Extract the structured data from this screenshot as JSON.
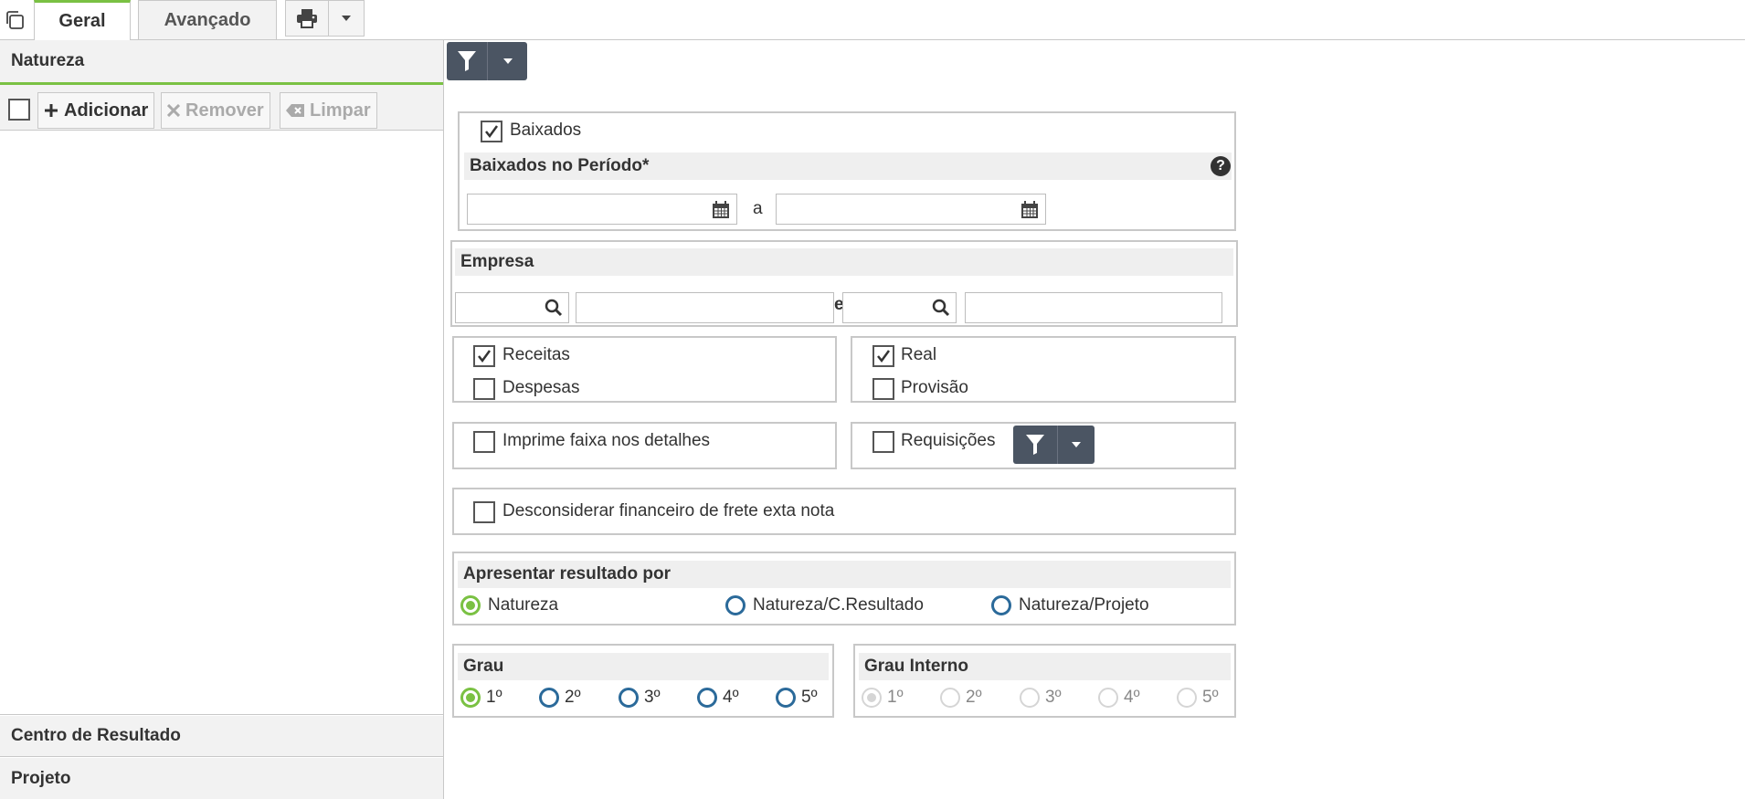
{
  "tabs": [
    {
      "label": "Geral",
      "active": true
    },
    {
      "label": "Avançado",
      "active": false
    }
  ],
  "colors": {
    "accent": "#7ac143",
    "dark_button": "#4b5563",
    "radio_blue": "#2b6a9a"
  },
  "left": {
    "natureza": {
      "title": "Natureza",
      "buttons": {
        "add": "Adicionar",
        "remove": "Remover",
        "clear": "Limpar"
      }
    },
    "centro_resultado": {
      "title": "Centro de Resultado"
    },
    "projeto": {
      "title": "Projeto"
    }
  },
  "baixados": {
    "label": "Baixados",
    "checked": true,
    "periodo_title": "Baixados no Período*",
    "separator": "a",
    "start_date": "",
    "end_date": ""
  },
  "empresa": {
    "title": "Empresa",
    "separator": "e",
    "code_from": "",
    "name_from": "",
    "code_to": "",
    "name_to": ""
  },
  "tipo": {
    "receitas": {
      "label": "Receitas",
      "checked": true
    },
    "despesas": {
      "label": "Despesas",
      "checked": false
    },
    "real": {
      "label": "Real",
      "checked": true
    },
    "provisao": {
      "label": "Provisão",
      "checked": false
    }
  },
  "options": {
    "imprime_faixa": {
      "label": "Imprime faixa nos detalhes",
      "checked": false
    },
    "requisicoes": {
      "label": "Requisições",
      "checked": false
    },
    "desconsiderar_frete": {
      "label": "Desconsiderar financeiro de frete exta nota",
      "checked": false
    }
  },
  "apresentar": {
    "title": "Apresentar resultado por",
    "options": [
      "Natureza",
      "Natureza/C.Resultado",
      "Natureza/Projeto"
    ],
    "selected": "Natureza"
  },
  "grau": {
    "title": "Grau",
    "options": [
      "1º",
      "2º",
      "3º",
      "4º",
      "5º"
    ],
    "selected": "1º"
  },
  "grau_interno": {
    "title": "Grau Interno",
    "options": [
      "1º",
      "2º",
      "3º",
      "4º",
      "5º"
    ],
    "selected": "1º",
    "disabled": true
  }
}
